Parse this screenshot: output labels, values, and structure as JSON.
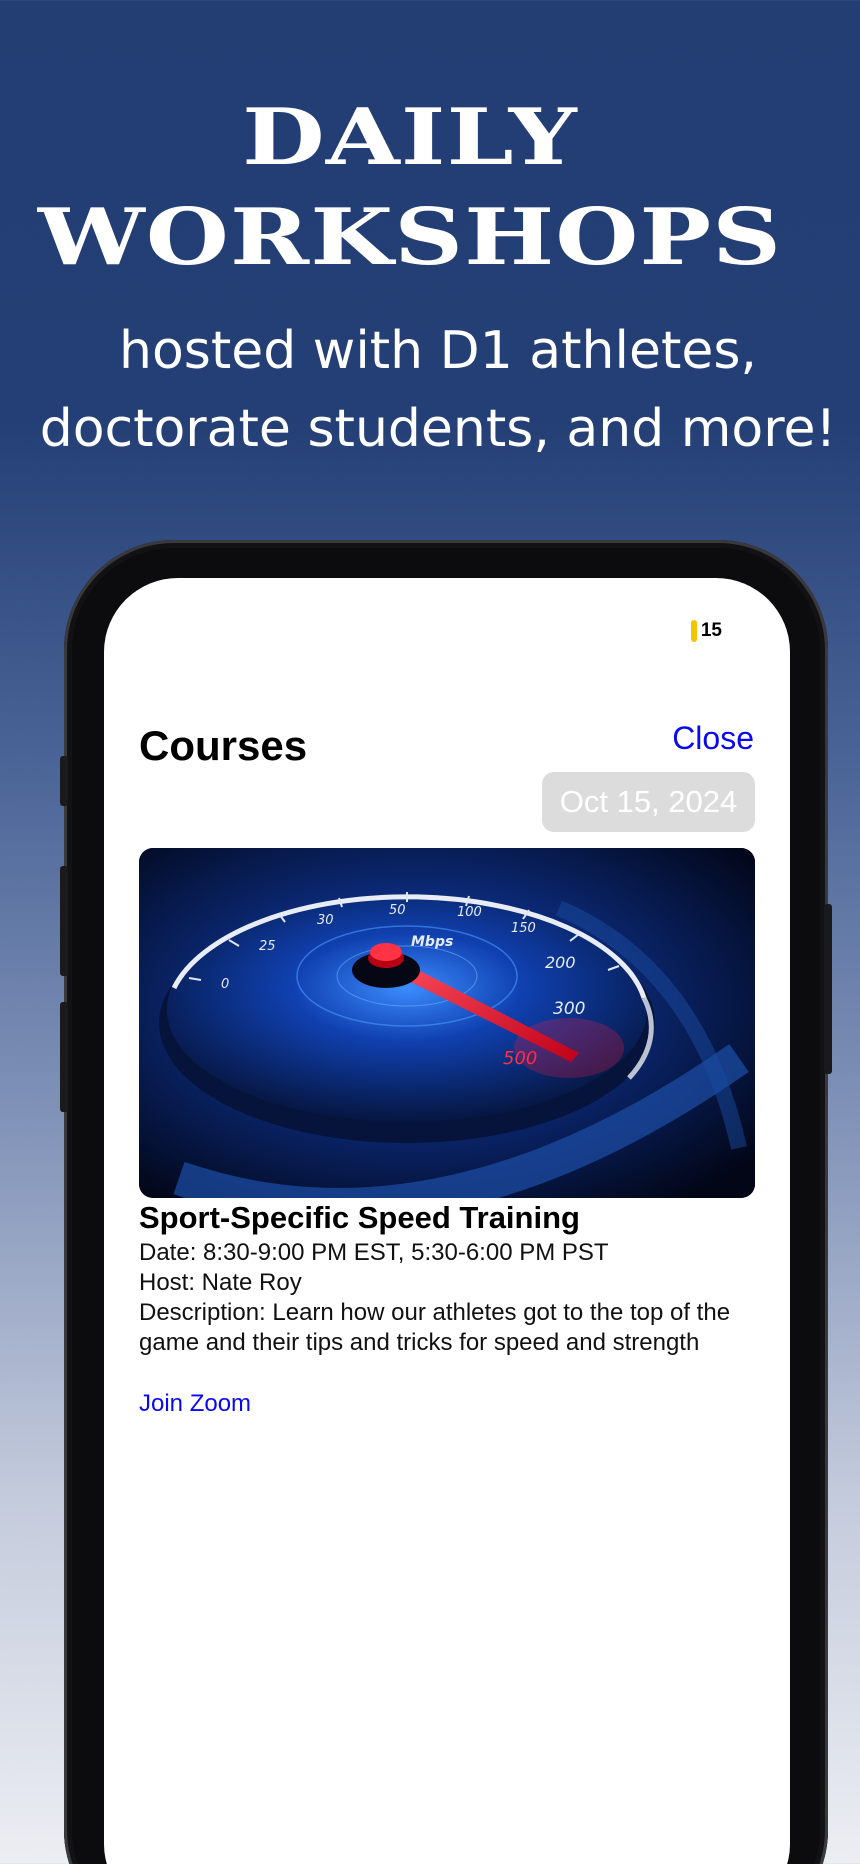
{
  "promo": {
    "title_line1": "DAILY",
    "title_line2": "WORKSHOPS",
    "subtitle_line1": "hosted with D1 athletes,",
    "subtitle_line2": "doctorate students, and more!"
  },
  "status_bar": {
    "battery_level": "15",
    "battery_color": "#f5c400"
  },
  "header": {
    "title": "Courses",
    "close_label": "Close",
    "date": "Oct 15, 2024"
  },
  "course": {
    "image_icon": "speedometer-image",
    "gauge_ticks": [
      "0",
      "25",
      "30",
      "50",
      "100",
      "150",
      "200",
      "300",
      "500"
    ],
    "gauge_unit": "Mbps",
    "title": "Sport-Specific Speed Training",
    "date": "Date:  8:30-9:00 PM EST, 5:30-6:00 PM PST",
    "host": "Host: Nate Roy",
    "description": "Description: Learn how our athletes got to the top of the game and their tips and tricks for speed and strength",
    "link_label": "Join Zoom"
  },
  "colors": {
    "background_top": "#223e73",
    "link": "#0a0af2"
  }
}
